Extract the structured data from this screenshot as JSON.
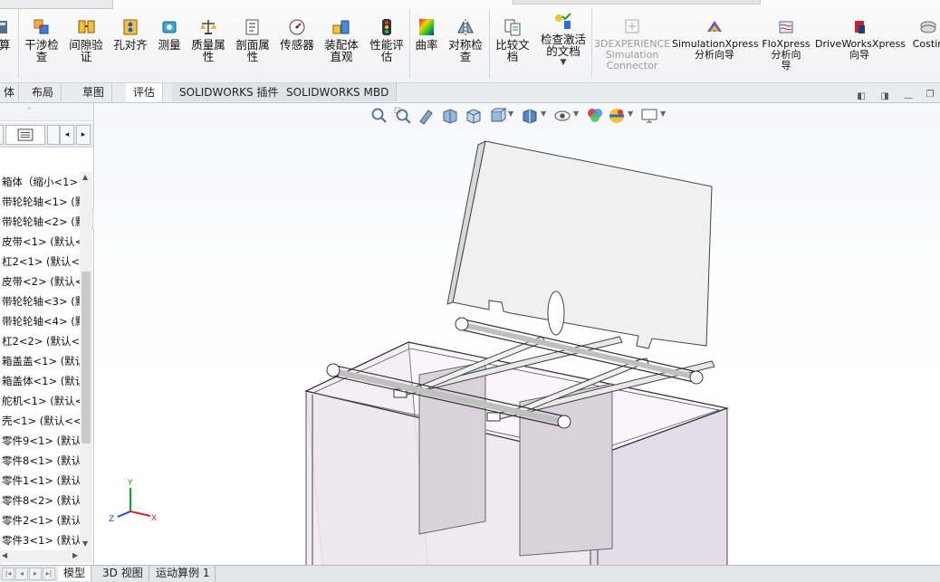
{
  "ribbon": {
    "buttons": [
      {
        "label": "算",
        "icon": "calculator-icon"
      },
      {
        "label": "干涉检\n查",
        "icon": "interference-check-icon"
      },
      {
        "label": "间隙验\n证",
        "icon": "clearance-verify-icon"
      },
      {
        "label": "孔对齐",
        "icon": "hole-align-icon"
      },
      {
        "label": "测量",
        "icon": "measure-icon"
      },
      {
        "label": "质量属\n性",
        "icon": "mass-properties-icon"
      },
      {
        "label": "剖面属\n性",
        "icon": "section-properties-icon"
      },
      {
        "label": "传感器",
        "icon": "sensor-icon"
      },
      {
        "label": "装配体\n直观",
        "icon": "assembly-visualization-icon"
      },
      {
        "label": "性能评\n估",
        "icon": "performance-evaluation-icon"
      },
      {
        "label": "曲率",
        "icon": "curvature-icon"
      },
      {
        "label": "对称检\n查",
        "icon": "symmetry-check-icon"
      },
      {
        "label": "比较文\n档",
        "icon": "compare-documents-icon"
      },
      {
        "label": "检查激活\n的文档",
        "icon": "check-active-document-icon"
      },
      {
        "label": "3DEXPERIENCE\nSimulation\nConnector",
        "icon": "3dexperience-icon"
      },
      {
        "label": "SimulationXpress\n分析向导",
        "icon": "simulationxpress-icon"
      },
      {
        "label": "FloXpress\n分析向\n导",
        "icon": "floxpress-icon"
      },
      {
        "label": "DriveWorksXpress\n向导",
        "icon": "driveworksxpress-icon"
      },
      {
        "label": "Costin",
        "icon": "costing-icon"
      }
    ]
  },
  "tabs": [
    "体",
    "布局",
    "草图",
    "评估",
    "SOLIDWORKS 插件",
    "SOLIDWORKS MBD"
  ],
  "active_tab": "评估",
  "tree": {
    "items": [
      "箱体（缩小<1>",
      "带轮轮轴<1> (默",
      "带轮轮轴<2> (默",
      "皮带<1> (默认<",
      "杠2<1> (默认<",
      "皮带<2> (默认<",
      "带轮轮轴<3> (默",
      "带轮轮轴<4> (默",
      "杠2<2> (默认<",
      "箱盖盖<1> (默认",
      "箱盖体<1> (默认",
      "舵机<1> (默认<",
      "壳<1> (默认<<",
      "零件9<1> (默认",
      "零件8<1> (默认",
      "零件1<1> (默认",
      "零件8<2> (默认",
      "零件2<1> (默认",
      "零件3<1> (默认"
    ]
  },
  "triad": {
    "x": "X",
    "y": "Y",
    "z": "Z"
  },
  "bottom_tabs": [
    "模型",
    "3D 视图",
    "运动算例 1"
  ],
  "colors": {
    "accent": "#1f6fd1",
    "triad_x": "#d9262b",
    "triad_y": "#1b9a2e",
    "triad_z": "#2a3fd3"
  }
}
